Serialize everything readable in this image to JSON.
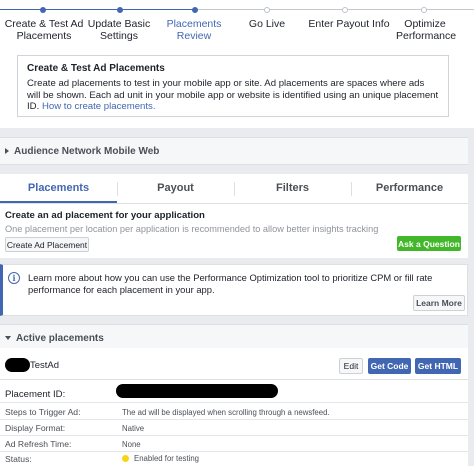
{
  "stepper": {
    "steps": [
      {
        "line1": "Create & Test Ad",
        "line2": "Placements",
        "state": "done"
      },
      {
        "line1": "Update Basic",
        "line2": "Settings",
        "state": "done"
      },
      {
        "line1": "Placements",
        "line2": "Review",
        "state": "active"
      },
      {
        "line1": "Go Live",
        "line2": "",
        "state": "todo"
      },
      {
        "line1": "Enter Payout Info",
        "line2": "",
        "state": "todo"
      },
      {
        "line1": "Optimize",
        "line2": "Performance",
        "state": "todo"
      }
    ]
  },
  "info_box": {
    "title": "Create & Test Ad Placements",
    "text": "Create ad placements to test in your mobile app or site. Ad placements are spaces where ads will be shown. Each ad unit in your mobile app or website is identified using an unique placement ID.",
    "link": "How to create placements."
  },
  "audience_network": {
    "label": "Audience Network Mobile Web"
  },
  "tabs": [
    {
      "label": "Placements"
    },
    {
      "label": "Payout"
    },
    {
      "label": "Filters"
    },
    {
      "label": "Performance"
    }
  ],
  "create": {
    "title": "Create an ad placement for your application",
    "subtitle": "One placement per location per application is recommended to allow better insights tracking",
    "create_button": "Create Ad Placement",
    "ask_button": "Ask a Question"
  },
  "notice": {
    "icon": "info-icon",
    "text": "Learn more about how you can use the Performance Optimization tool to prioritize CPM or fill rate performance for each placement in your app.",
    "button": "Learn More"
  },
  "active_placements": {
    "header": "Active placements",
    "ad_name": "TestAd",
    "edit_button": "Edit",
    "get_code_button": "Get Code",
    "get_html_button": "Get HTML",
    "placement_id_label": "Placement ID:",
    "rows": [
      {
        "label": "Steps to Trigger Ad:",
        "value": "The ad will be displayed when scrolling through a newsfeed."
      },
      {
        "label": "Display Format:",
        "value": "Native"
      },
      {
        "label": "Ad Refresh Time:",
        "value": "None"
      },
      {
        "label": "Status:",
        "value": "Enabled for testing"
      }
    ]
  },
  "colors": {
    "accent": "#4267b2",
    "green": "#42b72a",
    "status_yellow": "#f7d414"
  }
}
